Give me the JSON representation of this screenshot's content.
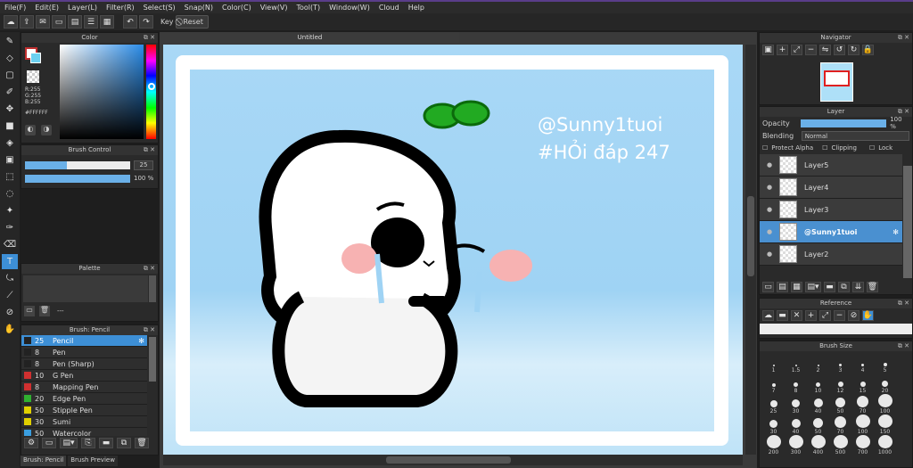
{
  "menu": [
    "File(F)",
    "Edit(E)",
    "Layer(L)",
    "Filter(R)",
    "Select(S)",
    "Snap(N)",
    "Color(C)",
    "View(V)",
    "Tool(T)",
    "Window(W)",
    "Cloud",
    "Help"
  ],
  "toolbar": {
    "key_label": "Key",
    "reset_label": "Reset"
  },
  "document": {
    "title": "Untitled"
  },
  "color_panel": {
    "title": "Color",
    "r": "R:255",
    "g": "G:255",
    "b": "B:255",
    "hex": "#FFFFFF"
  },
  "brush_control": {
    "title": "Brush Control",
    "size": "25",
    "opacity": "100 %",
    "size_fill": 0.4,
    "opacity_fill": 1.0
  },
  "palette": {
    "title": "Palette",
    "dash": "---"
  },
  "brush_list": {
    "title": "Brush: Pencil",
    "items": [
      {
        "size": "25",
        "name": "Pencil",
        "color": "#222222"
      },
      {
        "size": "8",
        "name": "Pen",
        "color": "#222222"
      },
      {
        "size": "8",
        "name": "Pen (Sharp)",
        "color": "#222222"
      },
      {
        "size": "10",
        "name": "G Pen",
        "color": "#d03030"
      },
      {
        "size": "8",
        "name": "Mapping Pen",
        "color": "#d03030"
      },
      {
        "size": "20",
        "name": "Edge Pen",
        "color": "#30b030"
      },
      {
        "size": "50",
        "name": "Stipple Pen",
        "color": "#e0d000"
      },
      {
        "size": "30",
        "name": "Sumi",
        "color": "#e0d000"
      },
      {
        "size": "50",
        "name": "Watercolor",
        "color": "#3a9ee0"
      }
    ]
  },
  "bottom_tabs": [
    "Brush: Pencil",
    "Brush Preview"
  ],
  "artwork": {
    "line1": "@Sunny1tuoi",
    "line2": "#HỎi đáp 247"
  },
  "navigator": {
    "title": "Navigator"
  },
  "layer_panel": {
    "title": "Layer",
    "opacity_label": "Opacity",
    "opacity_value": "100 %",
    "blending_label": "Blending",
    "blending_value": "Normal",
    "protect_alpha": "Protect Alpha",
    "clipping": "Clipping",
    "lock": "Lock",
    "layers": [
      "Layer5",
      "Layer4",
      "Layer3",
      "@Sunny1tuoi",
      "Layer2"
    ]
  },
  "reference": {
    "title": "Reference"
  },
  "brush_size": {
    "title": "Brush Size",
    "rows": [
      [
        "1",
        "1.5",
        "2",
        "3",
        "4",
        "5"
      ],
      [
        "7",
        "8",
        "10",
        "12",
        "15",
        "20"
      ],
      [
        "25",
        "30",
        "40",
        "50",
        "70",
        "100"
      ],
      [
        "30",
        "40",
        "50",
        "70",
        "100",
        "150"
      ],
      [
        "200",
        "300",
        "400",
        "500",
        "700",
        "1000"
      ]
    ]
  }
}
